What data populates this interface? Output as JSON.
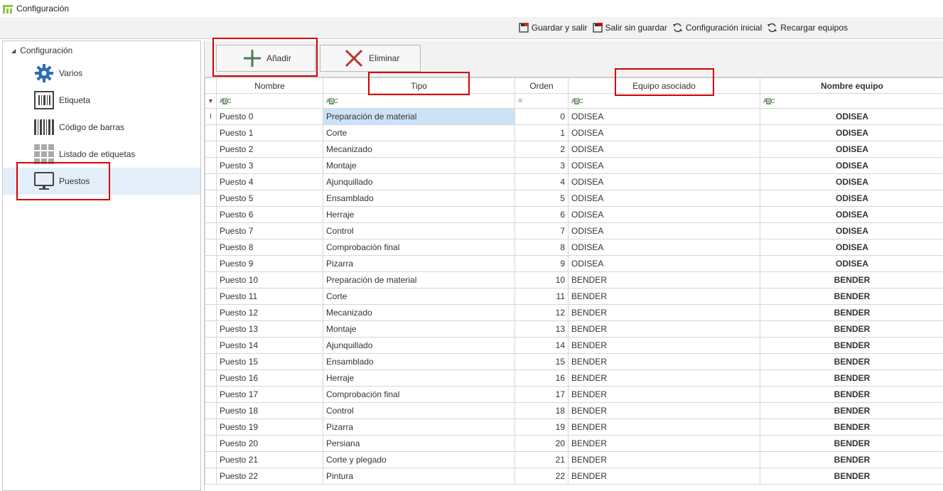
{
  "window": {
    "title": "Configuración"
  },
  "toolbar": {
    "save_exit": "Guardar y salir",
    "exit_nosave": "Salir sin guardar",
    "initial_config": "Configuración inicial",
    "reload": "Recargar equipos"
  },
  "sidebar": {
    "root": "Configuración",
    "items": [
      {
        "label": "Varios",
        "icon": "gear-icon"
      },
      {
        "label": "Etiqueta",
        "icon": "label-icon"
      },
      {
        "label": "Código de barras",
        "icon": "barcode-icon"
      },
      {
        "label": "Listado de etiquetas",
        "icon": "grid-icon"
      },
      {
        "label": "Puestos",
        "icon": "monitor-icon"
      }
    ]
  },
  "actions": {
    "add": "Añadir",
    "delete": "Eliminar"
  },
  "grid": {
    "columns": [
      "Nombre",
      "Tipo",
      "Orden",
      "Equipo asociado",
      "Nombre equipo"
    ],
    "rows": [
      [
        "Puesto 0",
        "Preparación de material",
        "0",
        "ODISEA",
        "ODISEA"
      ],
      [
        "Puesto 1",
        "Corte",
        "1",
        "ODISEA",
        "ODISEA"
      ],
      [
        "Puesto 2",
        "Mecanizado",
        "2",
        "ODISEA",
        "ODISEA"
      ],
      [
        "Puesto 3",
        "Montaje",
        "3",
        "ODISEA",
        "ODISEA"
      ],
      [
        "Puesto 4",
        "Ajunquillado",
        "4",
        "ODISEA",
        "ODISEA"
      ],
      [
        "Puesto 5",
        "Ensamblado",
        "5",
        "ODISEA",
        "ODISEA"
      ],
      [
        "Puesto 6",
        "Herraje",
        "6",
        "ODISEA",
        "ODISEA"
      ],
      [
        "Puesto 7",
        "Control",
        "7",
        "ODISEA",
        "ODISEA"
      ],
      [
        "Puesto 8",
        "Comprobación final",
        "8",
        "ODISEA",
        "ODISEA"
      ],
      [
        "Puesto 9",
        "Pizarra",
        "9",
        "ODISEA",
        "ODISEA"
      ],
      [
        "Puesto 10",
        "Preparación de material",
        "10",
        "BENDER",
        "BENDER"
      ],
      [
        "Puesto 11",
        "Corte",
        "11",
        "BENDER",
        "BENDER"
      ],
      [
        "Puesto 12",
        "Mecanizado",
        "12",
        "BENDER",
        "BENDER"
      ],
      [
        "Puesto 13",
        "Montaje",
        "13",
        "BENDER",
        "BENDER"
      ],
      [
        "Puesto 14",
        "Ajunquillado",
        "14",
        "BENDER",
        "BENDER"
      ],
      [
        "Puesto 15",
        "Ensamblado",
        "15",
        "BENDER",
        "BENDER"
      ],
      [
        "Puesto 16",
        "Herraje",
        "16",
        "BENDER",
        "BENDER"
      ],
      [
        "Puesto 17",
        "Comprobación final",
        "17",
        "BENDER",
        "BENDER"
      ],
      [
        "Puesto 18",
        "Control",
        "18",
        "BENDER",
        "BENDER"
      ],
      [
        "Puesto 19",
        "Pizarra",
        "19",
        "BENDER",
        "BENDER"
      ],
      [
        "Puesto 20",
        "Persiana",
        "20",
        "BENDER",
        "BENDER"
      ],
      [
        "Puesto 21",
        "Corte y plegado",
        "21",
        "BENDER",
        "BENDER"
      ],
      [
        "Puesto 22",
        "Pintura",
        "22",
        "BENDER",
        "BENDER"
      ]
    ]
  },
  "colors": {
    "highlight_box": "#d40000",
    "selected_bg": "#e3eef9",
    "cell_selected": "#cce3f7"
  }
}
